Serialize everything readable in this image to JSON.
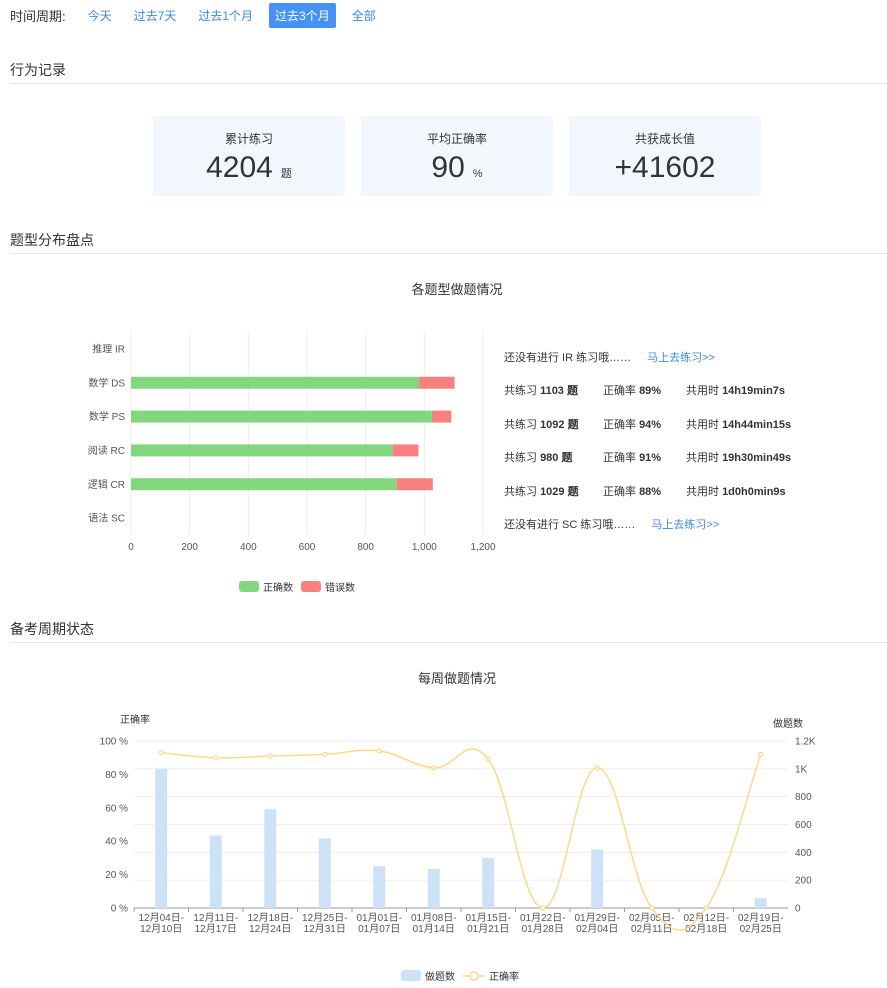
{
  "period": {
    "label": "时间周期:",
    "options": [
      "今天",
      "过去7天",
      "过去1个月",
      "过去3个月",
      "全部"
    ],
    "active_index": 3
  },
  "sections": {
    "behavior": "行为记录",
    "distribution": "题型分布盘点",
    "cycle": "备考周期状态"
  },
  "stats": [
    {
      "label": "累计练习",
      "value": "4204",
      "unit": "题"
    },
    {
      "label": "平均正确率",
      "value": "90",
      "unit": "%"
    },
    {
      "label": "共获成长值",
      "value": "+41602",
      "unit": ""
    }
  ],
  "type_rows": [
    {
      "kind": "empty",
      "text": "还没有进行 IR 练习哦……",
      "link": "马上去练习>>"
    },
    {
      "kind": "data",
      "p1": "共练习 ",
      "count": "1103 题",
      "p2": "正确率 ",
      "acc": "89%",
      "p3": "共用时 ",
      "time": "14h19min7s"
    },
    {
      "kind": "data",
      "p1": "共练习 ",
      "count": "1092 题",
      "p2": "正确率 ",
      "acc": "94%",
      "p3": "共用时 ",
      "time": "14h44min15s"
    },
    {
      "kind": "data",
      "p1": "共练习 ",
      "count": "980 题",
      "p2": "正确率 ",
      "acc": "91%",
      "p3": "共用时 ",
      "time": "19h30min49s"
    },
    {
      "kind": "data",
      "p1": "共练习 ",
      "count": "1029 题",
      "p2": "正确率 ",
      "acc": "88%",
      "p3": "共用时 ",
      "time": "1d0h0min9s"
    },
    {
      "kind": "empty",
      "text": "还没有进行 SC 练习哦……",
      "link": "马上去练习>>"
    }
  ],
  "colors": {
    "correct": "#81d67e",
    "wrong": "#f8817f",
    "weekly_bar": "#cde2f6",
    "accuracy_line": "#fbd988",
    "accent": "#4592f4",
    "card_bg": "#f2f7fe"
  },
  "chart_data": [
    {
      "type": "bar",
      "orientation": "horizontal",
      "stacked": true,
      "title": "各题型做题情况",
      "categories": [
        "推理 IR",
        "数学 DS",
        "数学 PS",
        "阅读 RC",
        "逻辑 CR",
        "语法 SC"
      ],
      "series": [
        {
          "name": "正确数",
          "values": [
            0,
            982,
            1026,
            892,
            906,
            0
          ]
        },
        {
          "name": "错误数",
          "values": [
            0,
            121,
            66,
            88,
            123,
            0
          ]
        }
      ],
      "xticks": [
        "0",
        "200",
        "400",
        "600",
        "800",
        "1,000",
        "1,200"
      ],
      "xlim": [
        0,
        1200
      ],
      "grid": true,
      "legend": "bottom"
    },
    {
      "type": "bar",
      "title": "每周做题情况",
      "categories": [
        "12月04日-12月10日",
        "12月11日-12月17日",
        "12月18日-12月24日",
        "12月25日-12月31日",
        "01月01日-01月07日",
        "01月08日-01月14日",
        "01月15日-01月21日",
        "01月22日-01月28日",
        "01月29日-02月04日",
        "02月05日-02月11日",
        "02月12日-02月18日",
        "02月19日-02月25日"
      ],
      "series": [
        {
          "name": "做题数",
          "type": "bar",
          "axis": "right",
          "values": [
            1000,
            520,
            710,
            500,
            300,
            280,
            360,
            0,
            420,
            0,
            0,
            70
          ]
        },
        {
          "name": "正确率",
          "type": "line",
          "axis": "left",
          "smooth": true,
          "values": [
            93,
            90,
            91,
            92,
            94,
            84,
            89,
            0,
            84,
            0,
            0,
            92
          ]
        }
      ],
      "ylabel_left": "正确率",
      "ylabel_right": "做题数",
      "yticks_left": [
        "0 %",
        "20 %",
        "40 %",
        "60 %",
        "80 %",
        "100 %"
      ],
      "yticks_right": [
        "0",
        "200",
        "400",
        "600",
        "800",
        "1K",
        "1.2K"
      ],
      "ylim_left": [
        0,
        100
      ],
      "ylim_right": [
        0,
        1200
      ],
      "legend": "bottom"
    }
  ]
}
